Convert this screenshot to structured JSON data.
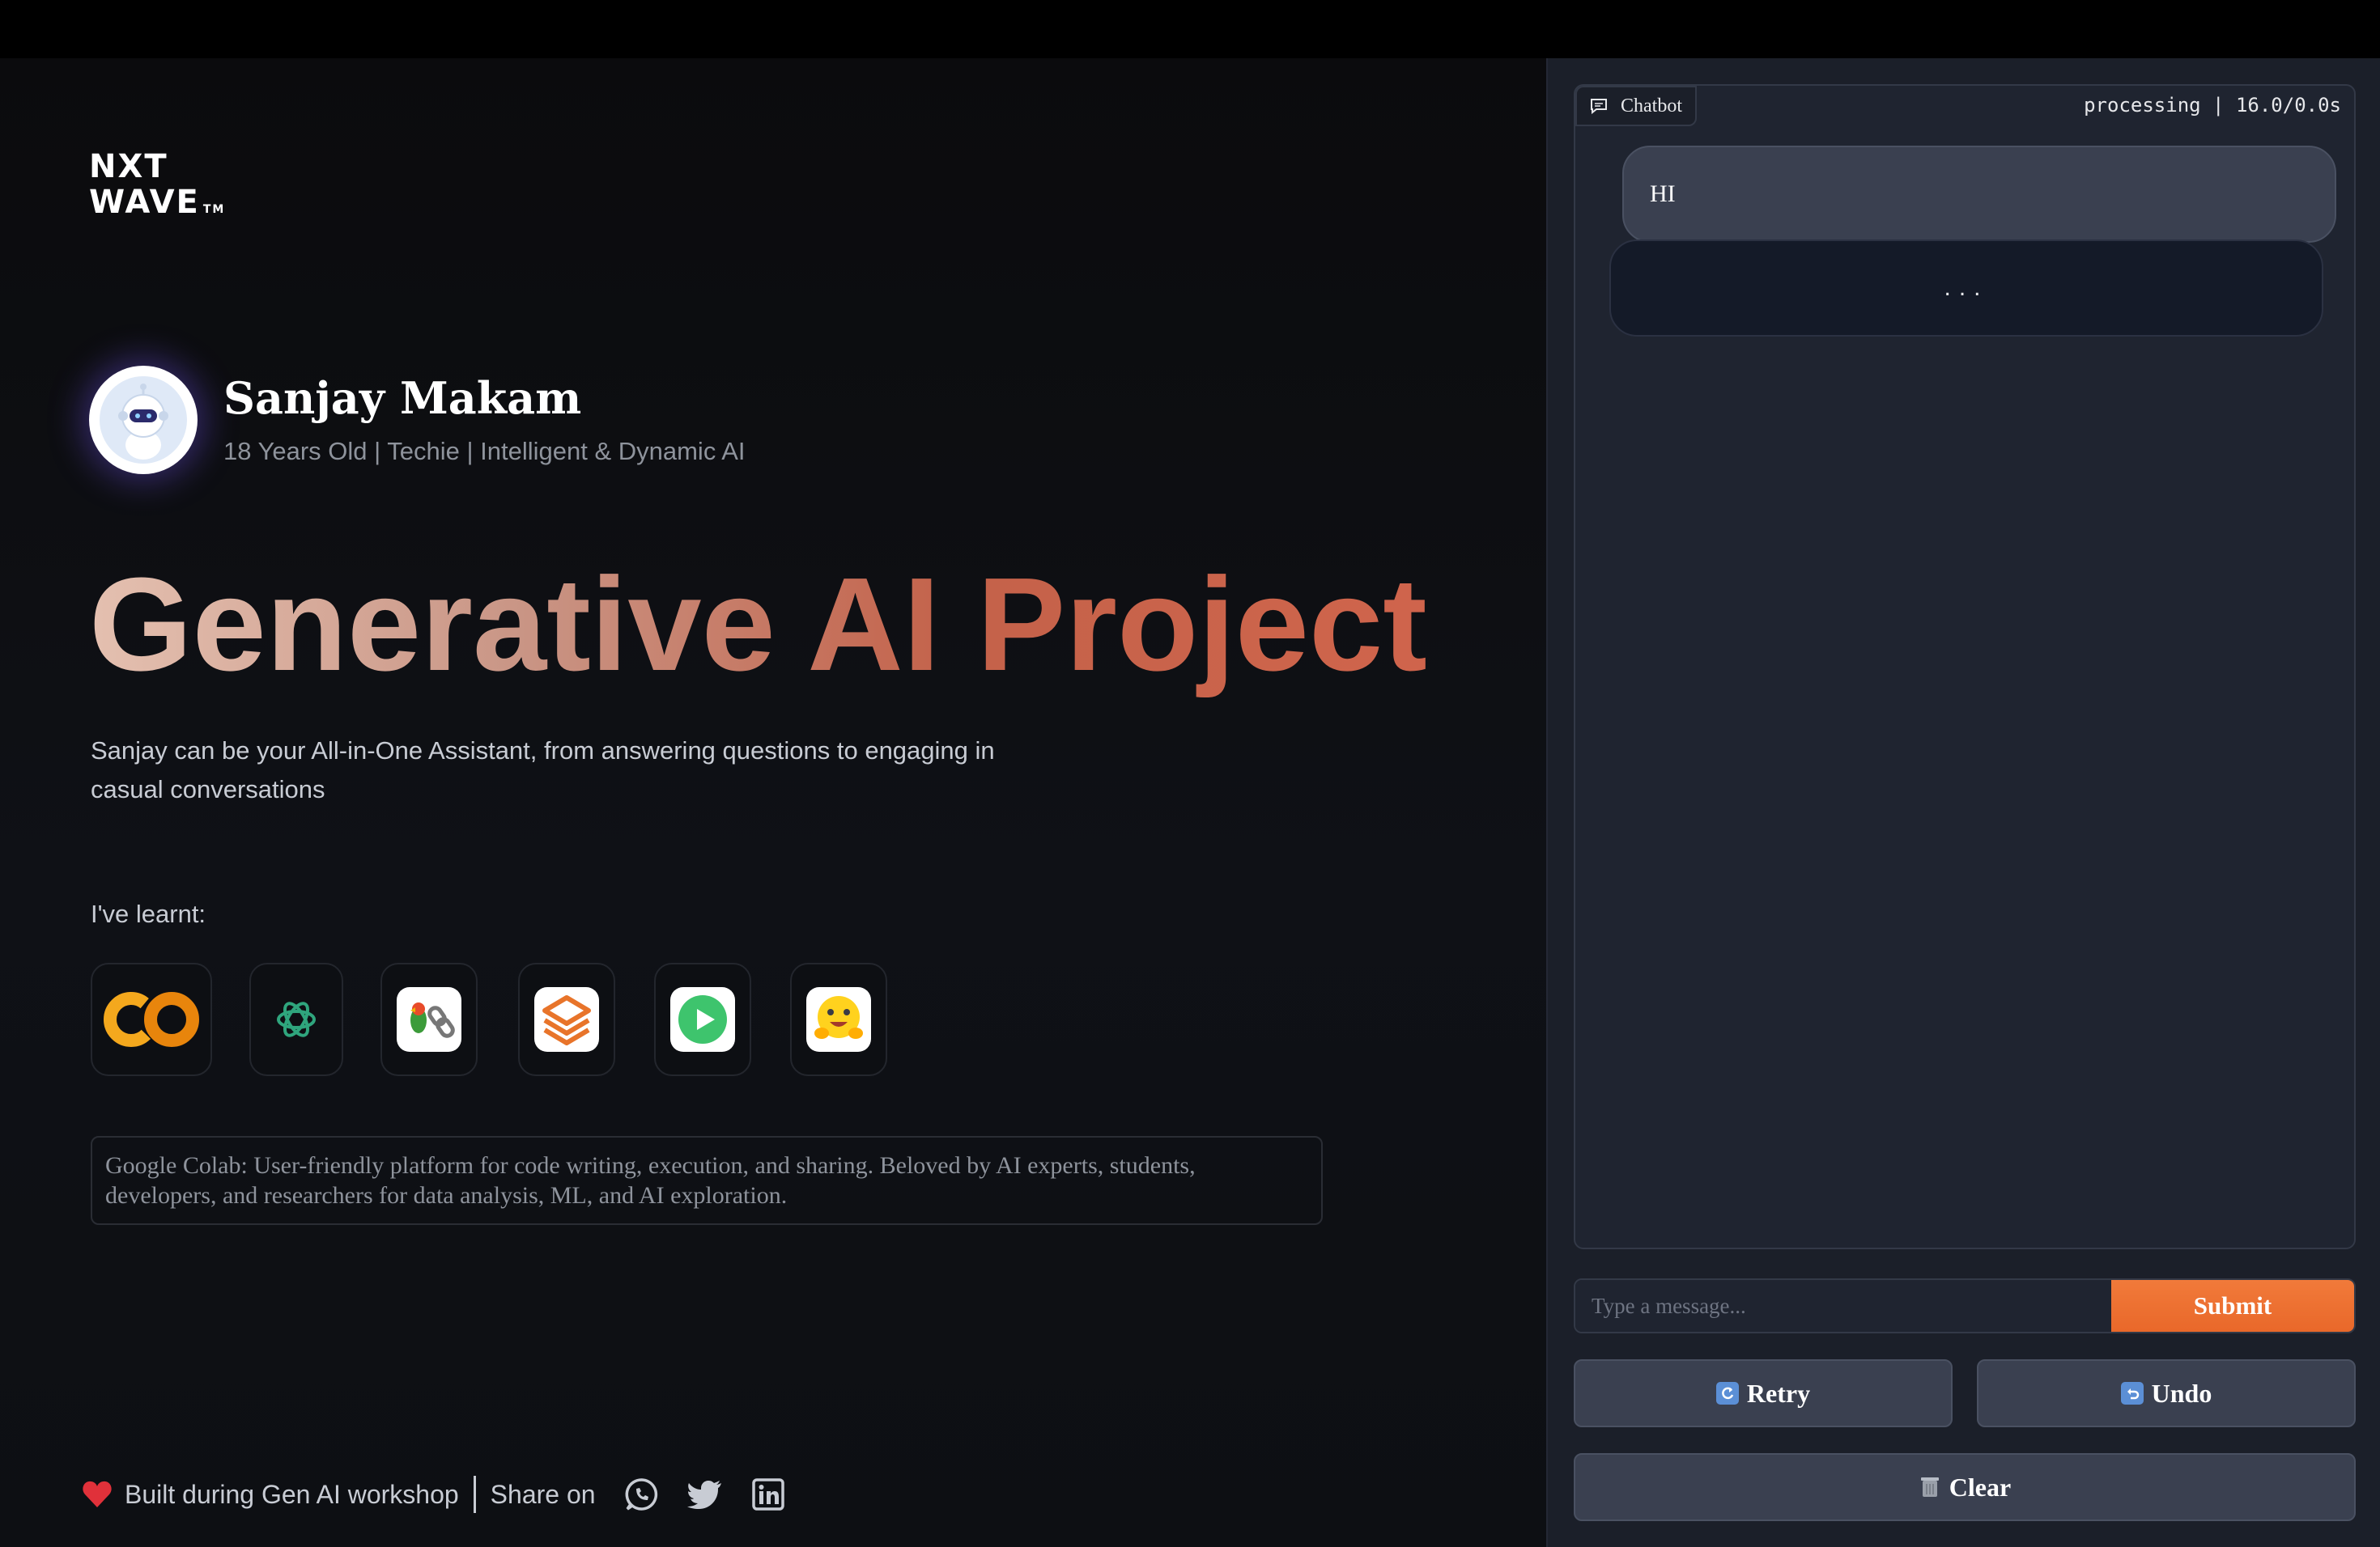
{
  "brand": {
    "line1": "NXT",
    "line2": "WAVE",
    "tm": "TM"
  },
  "profile": {
    "name": "Sanjay Makam",
    "tagline": "18 Years Old | Techie | Intelligent & Dynamic AI"
  },
  "hero": {
    "title": "Generative AI Project",
    "subtitle": "Sanjay can be your All-in-One Assistant, from answering questions to engaging in casual conversations"
  },
  "learnt": {
    "label": "I've learnt:",
    "tools": [
      {
        "icon": "google-colab-icon"
      },
      {
        "icon": "openai-icon"
      },
      {
        "icon": "langchain-icon"
      },
      {
        "icon": "layers-stack-icon"
      },
      {
        "icon": "play-icon"
      },
      {
        "icon": "hugging-face-icon"
      }
    ],
    "description": "Google Colab: User-friendly platform for code writing, execution, and sharing. Beloved by AI experts, students, developers, and researchers for data analysis, ML, and AI exploration."
  },
  "footer": {
    "built": "Built during Gen AI workshop",
    "share": "Share on",
    "socials": [
      "whatsapp-icon",
      "twitter-icon",
      "linkedin-icon"
    ]
  },
  "chat": {
    "label": "Chatbot",
    "status": "processing | 16.0/0.0s",
    "messages": [
      {
        "role": "user",
        "text": "HI"
      },
      {
        "role": "bot",
        "text": "..."
      }
    ],
    "input_placeholder": "Type a message...",
    "submit_label": "Submit",
    "retry_label": "Retry",
    "undo_label": "Undo",
    "clear_label": "Clear"
  },
  "colors": {
    "accent": "#e9682a",
    "panel": "#1b1f29",
    "bubble_user": "#3a4050",
    "bubble_bot": "#141a28"
  }
}
